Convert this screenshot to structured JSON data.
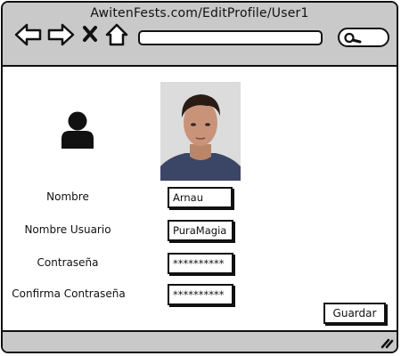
{
  "browser": {
    "url_title": "AwitenFests.com/EditProfile/User1",
    "address_value": ""
  },
  "profile": {
    "avatar_icon": "user-icon",
    "photo": "profile-photo"
  },
  "form": {
    "fields": [
      {
        "label": "Nombre",
        "value": "Arnau"
      },
      {
        "label": "Nombre Usuario",
        "value": "PuraMagia"
      },
      {
        "label": "Contraseña",
        "value": "**********"
      },
      {
        "label": "Confirma Contraseña",
        "value": "**********"
      }
    ],
    "save_label": "Guardar"
  }
}
